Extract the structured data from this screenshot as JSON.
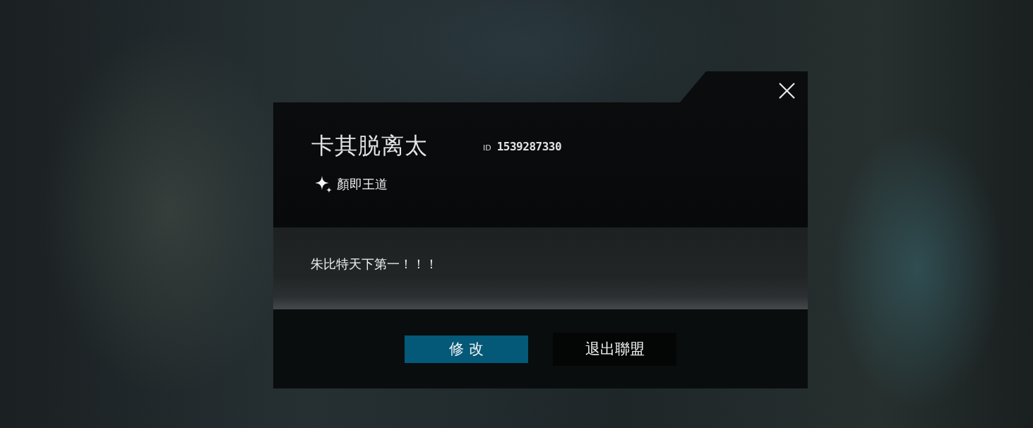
{
  "profile": {
    "name": "卡其脱离太",
    "id_label": "ID",
    "id_value": "1539287330",
    "title": "顏即王道"
  },
  "motto": "朱比特天下第一！！！",
  "buttons": [
    {
      "label": "修 改",
      "kind": "primary"
    },
    {
      "label": "退出聯盟",
      "kind": "secondary"
    }
  ]
}
